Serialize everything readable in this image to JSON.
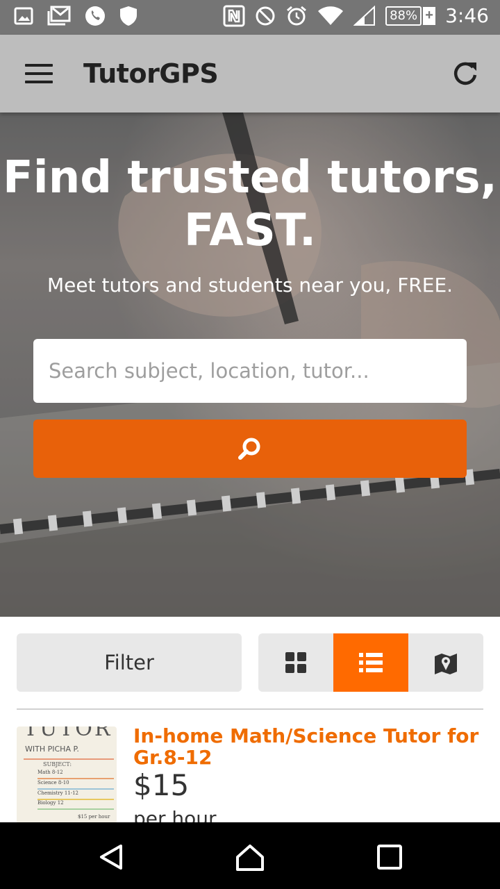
{
  "status_bar": {
    "battery": "88%",
    "battery_charging": "+",
    "time": "3:46",
    "left_icons": [
      "image-icon",
      "gmail-icon",
      "phone-icon",
      "shield-icon"
    ],
    "right_icons": [
      "nfc-icon",
      "do-not-disturb-icon",
      "alarm-icon",
      "wifi-icon",
      "signal-icon"
    ]
  },
  "app_bar": {
    "title": "TutorGPS",
    "menu_icon": "menu-icon",
    "refresh_icon": "refresh-icon"
  },
  "hero": {
    "title_line1": "Find trusted tutors,",
    "title_line2": "FAST.",
    "subtitle": "Meet tutors and students near you, FREE.",
    "search_placeholder": "Search subject, location, tutor...",
    "search_button_icon": "search-icon"
  },
  "controls": {
    "filter_label": "Filter",
    "views": [
      {
        "name": "grid-view",
        "icon": "grid-icon",
        "active": false
      },
      {
        "name": "list-view",
        "icon": "list-icon",
        "active": true
      },
      {
        "name": "map-view",
        "icon": "map-icon",
        "active": false
      }
    ]
  },
  "listing": {
    "thumbnail": {
      "heading": "TUTOR",
      "with": "WITH PICHA P.",
      "subject_label": "SUBJECT:",
      "items": [
        "Math 8-12",
        "Science 8-10",
        "Chemistry 11-12",
        "Biology 12"
      ],
      "price_note": "$15 per hour"
    },
    "title": "In-home Math/Science Tutor for Gr.8-12",
    "price": "$15",
    "per": "per hour"
  },
  "colors": {
    "accent": "#e8610a",
    "active_toggle": "#ff6a00",
    "listing_title": "#ef6c00",
    "app_bar": "#bdbdbd",
    "status_bar": "#757575"
  }
}
